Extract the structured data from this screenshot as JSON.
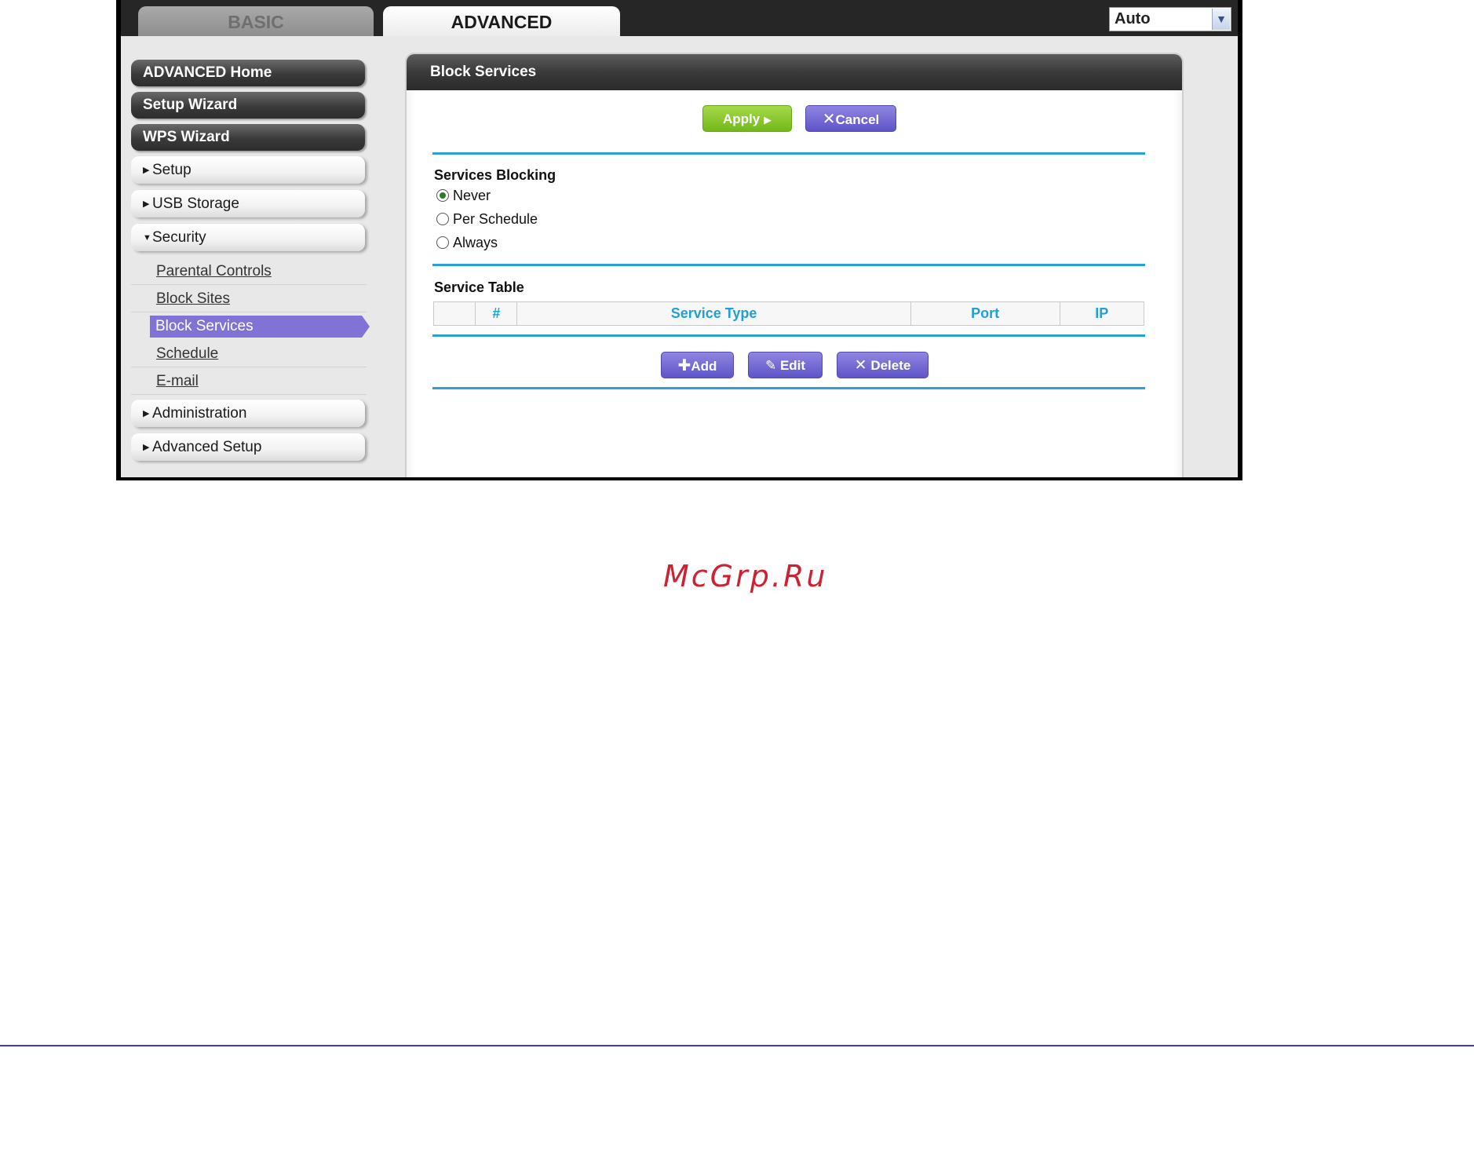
{
  "tabs": {
    "basic": "BASIC",
    "advanced": "ADVANCED"
  },
  "language_select": {
    "value": "Auto",
    "arrow": "chevron-down-icon"
  },
  "sidebar": {
    "advanced_home": "ADVANCED Home",
    "setup_wizard": "Setup Wizard",
    "wps_wizard": "WPS Wizard",
    "setup": "Setup",
    "usb_storage": "USB Storage",
    "security": "Security",
    "security_items": [
      "Parental Controls",
      "Block Sites",
      "Block Services",
      "Schedule",
      "E-mail"
    ],
    "administration": "Administration",
    "advanced_setup": "Advanced Setup"
  },
  "panel": {
    "title": "Block Services",
    "apply_label": "Apply",
    "cancel_label": "Cancel",
    "services_blocking_label": "Services Blocking",
    "options": [
      "Never",
      "Per Schedule",
      "Always"
    ],
    "selected_option": "Never",
    "service_table_label": "Service Table",
    "table_headers": [
      "",
      "#",
      "Service Type",
      "Port",
      "IP"
    ],
    "add_label": "Add",
    "edit_label": "Edit",
    "delete_label": "Delete"
  },
  "watermark": "McGrp.Ru",
  "colors": {
    "accent_blue": "#29a1d8",
    "purple": "#6a60d0",
    "green": "#86c42b",
    "active_item": "#8173d6"
  }
}
